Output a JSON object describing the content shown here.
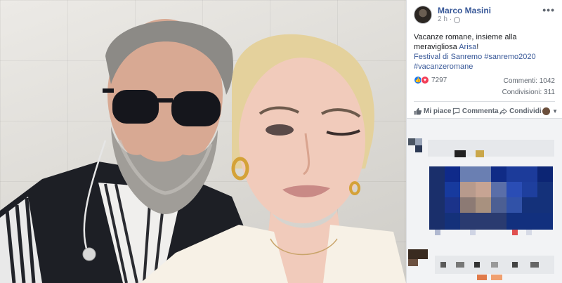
{
  "post": {
    "author": "Marco Masini",
    "time": "2 h",
    "text_before": "Vacanze romane, insieme alla meravigliosa ",
    "mention": "Arisa",
    "text_after": "!",
    "hashtags_line1": "Festival di Sanremo #sanremo2020",
    "hashtags_line2": "#vacanzeromane",
    "more_label": "•••"
  },
  "stats": {
    "reactions": "7297",
    "comments": "Commenti: 1042",
    "shares": "Condivisioni: 311"
  },
  "actions": {
    "like": "Mi piace",
    "comment": "Commenta",
    "share": "Condividi"
  },
  "colors": {
    "link": "#385898",
    "like": "#1877f2",
    "love": "#f33e58"
  },
  "icons": [
    "globe-icon",
    "like-icon",
    "love-icon",
    "comment-icon",
    "share-icon",
    "chevron-down-icon",
    "more-icon"
  ]
}
